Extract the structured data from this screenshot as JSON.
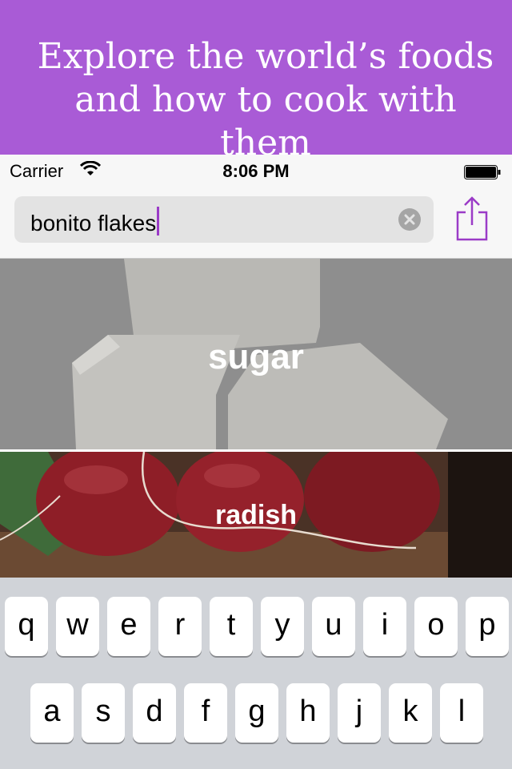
{
  "promo": {
    "line1": "Explore the world’s foods",
    "line2": "and how to cook with them"
  },
  "status_bar": {
    "carrier": "Carrier",
    "time": "8:06 PM"
  },
  "search": {
    "value": "bonito flakes"
  },
  "foods": [
    {
      "label": "sugar"
    },
    {
      "label": "radish"
    }
  ],
  "keyboard": {
    "row1": [
      "q",
      "w",
      "e",
      "r",
      "t",
      "y",
      "u",
      "i",
      "o",
      "p"
    ],
    "row2": [
      "a",
      "s",
      "d",
      "f",
      "g",
      "h",
      "j",
      "k",
      "l"
    ]
  },
  "colors": {
    "accent": "#a95bd6",
    "caret": "#9b3bc7",
    "share_icon": "#9b3bc7"
  },
  "icons": [
    "wifi-icon",
    "battery-icon",
    "clear-icon",
    "share-icon"
  ]
}
